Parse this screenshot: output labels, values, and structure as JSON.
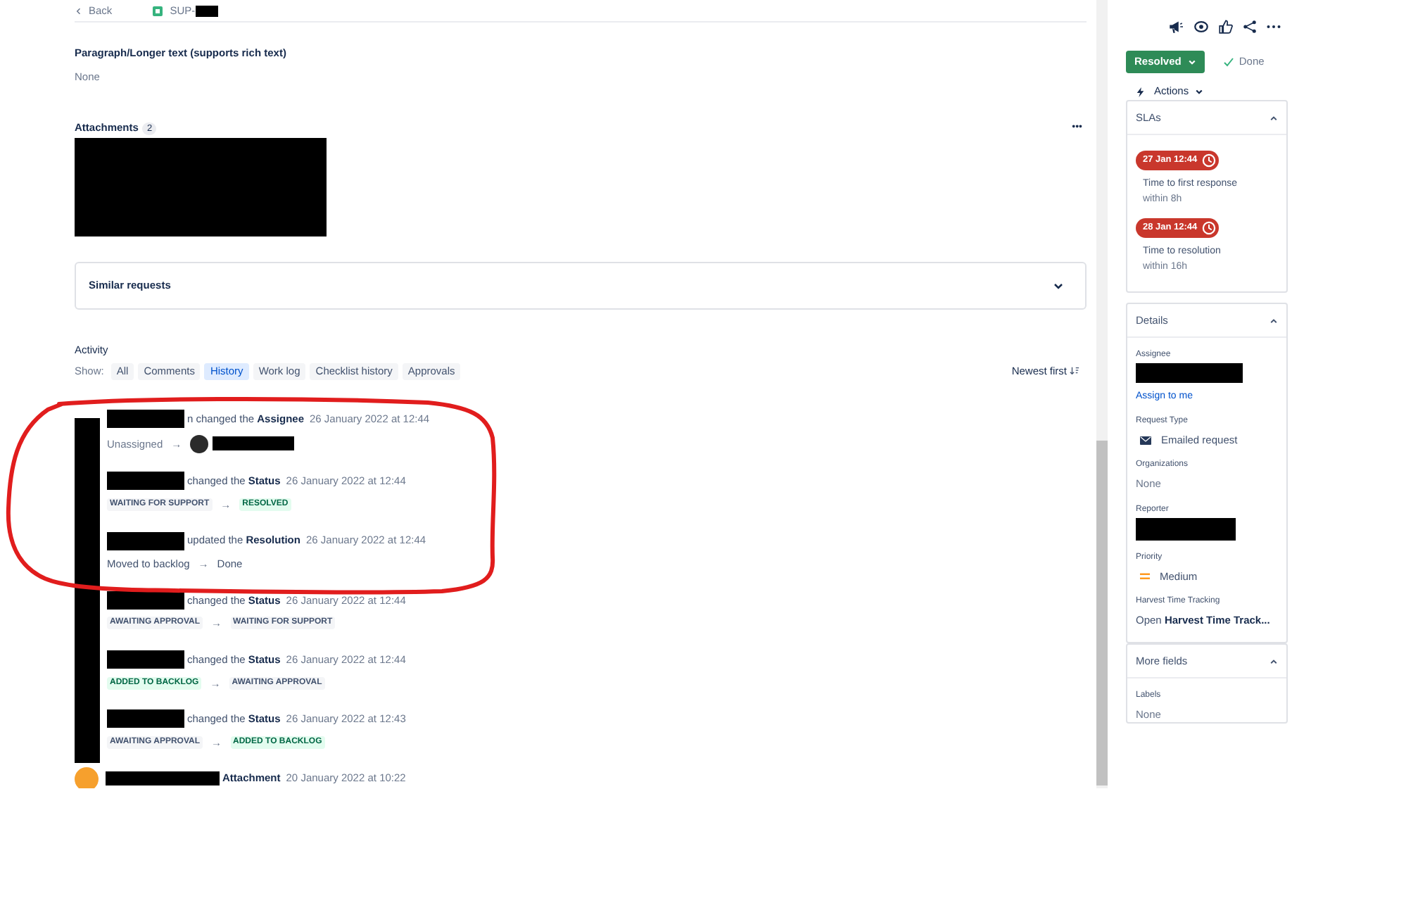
{
  "header": {
    "back": "Back",
    "issue_key": "SUP-"
  },
  "paragraph_field": {
    "label": "Paragraph/Longer text (supports rich text)",
    "value": "None"
  },
  "attachments": {
    "label": "Attachments",
    "count": "2",
    "more": "•••"
  },
  "similar_requests": {
    "label": "Similar requests",
    "expanded": false
  },
  "activity": {
    "title": "Activity",
    "show_label": "Show:",
    "sort": "Newest first",
    "tabs": [
      {
        "label": "All",
        "selected": false
      },
      {
        "label": "Comments",
        "selected": false
      },
      {
        "label": "History",
        "selected": true
      },
      {
        "label": "Work log",
        "selected": false
      },
      {
        "label": "Checklist history",
        "selected": false
      },
      {
        "label": "Approvals",
        "selected": false
      }
    ],
    "entries": [
      {
        "action": "n changed the **Assignee**",
        "time": "26 January 2022 at 12:44",
        "kind": "assignee",
        "from": "Unassigned",
        "arrow": "→"
      },
      {
        "action": "changed the **Status**",
        "time": "26 January 2022 at 12:44",
        "kind": "status",
        "from": "WAITING FOR SUPPORT",
        "from_success": false,
        "arrow": "→",
        "to": "RESOLVED",
        "to_success": true
      },
      {
        "action": "updated the **Resolution**",
        "time": "26 January 2022 at 12:44",
        "kind": "text",
        "from": "Moved to backlog",
        "arrow": "→",
        "to": "Done"
      },
      {
        "action": "changed the **Status**",
        "time": "26 January 2022 at 12:44",
        "kind": "status",
        "from": "AWAITING APPROVAL",
        "from_success": false,
        "arrow": "→",
        "to": "WAITING FOR SUPPORT",
        "to_success": false
      },
      {
        "action": "changed the **Status**",
        "time": "26 January 2022 at 12:44",
        "kind": "status",
        "from": "ADDED TO BACKLOG",
        "from_success": true,
        "arrow": "→",
        "to": "AWAITING APPROVAL",
        "to_success": false
      },
      {
        "action": "changed the **Status**",
        "time": "26 January 2022 at 12:43",
        "kind": "status",
        "from": "AWAITING APPROVAL",
        "from_success": false,
        "arrow": "→",
        "to": "ADDED TO BACKLOG",
        "to_success": true
      },
      {
        "action": "**Attachment**",
        "time": "20 January 2022 at 10:22",
        "kind": "attachment"
      }
    ]
  },
  "sidebar": {
    "status_button": "Resolved",
    "resolution": "Done",
    "actions": "Actions",
    "slas": {
      "title": "SLAs",
      "expanded": true,
      "items": [
        {
          "date": "27 Jan 12:44",
          "name": "Time to first response",
          "goal": "within 8h"
        },
        {
          "date": "28 Jan 12:44",
          "name": "Time to resolution",
          "goal": "within 16h"
        }
      ]
    },
    "details": {
      "title": "Details",
      "expanded": true,
      "fields": [
        {
          "label": "Assignee",
          "kind": "redacted",
          "link": "Assign to me"
        },
        {
          "label": "Request Type",
          "kind": "mail",
          "value": "Emailed request"
        },
        {
          "label": "Organizations",
          "kind": "empty",
          "value": "None"
        },
        {
          "label": "Reporter",
          "kind": "redacted"
        },
        {
          "label": "Priority",
          "kind": "priority",
          "value": "Medium"
        },
        {
          "label": "Harvest Time Tracking",
          "kind": "rich",
          "value": "Open **Harvest Time Track...**"
        }
      ]
    },
    "more_fields": {
      "title": "More fields",
      "expanded": true,
      "fields": [
        {
          "label": "Labels",
          "kind": "empty",
          "value": "None"
        }
      ]
    }
  }
}
